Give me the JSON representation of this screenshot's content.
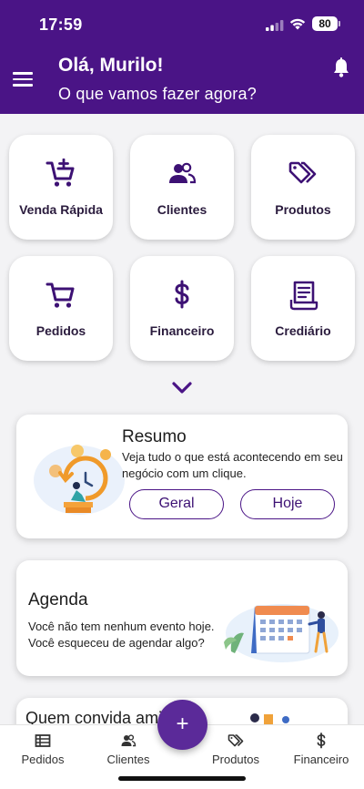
{
  "status": {
    "time": "17:59",
    "battery": "80"
  },
  "header": {
    "greeting": "Olá, Murilo!",
    "subtitle": "O que vamos fazer agora?"
  },
  "tiles": [
    {
      "label": "Venda Rápida",
      "icon": "cart-plus-icon"
    },
    {
      "label": "Clientes",
      "icon": "users-icon"
    },
    {
      "label": "Produtos",
      "icon": "tags-icon"
    },
    {
      "label": "Pedidos",
      "icon": "cart-icon"
    },
    {
      "label": "Financeiro",
      "icon": "dollar-icon"
    },
    {
      "label": "Crediário",
      "icon": "receipt-icon"
    }
  ],
  "resumo": {
    "title": "Resumo",
    "text": "Veja tudo o que está acontecendo em seu negócio com um clique.",
    "btn_geral": "Geral",
    "btn_hoje": "Hoje"
  },
  "agenda": {
    "title": "Agenda",
    "text": "Você não tem nenhum evento hoje. Você esqueceu de agendar algo?"
  },
  "invite": {
    "title": "Quem convida ami"
  },
  "nav": {
    "pedidos": "Pedidos",
    "clientes": "Clientes",
    "fab": "+",
    "produtos": "Produtos",
    "financeiro": "Financeiro"
  },
  "colors": {
    "primary": "#4a1486",
    "background": "#f3f3f5"
  }
}
